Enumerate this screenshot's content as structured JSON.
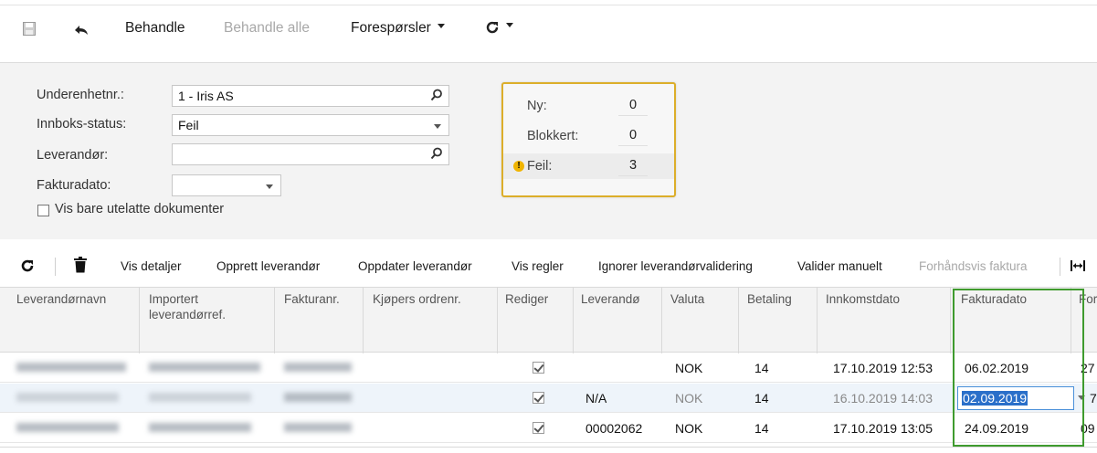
{
  "toolbar": {
    "process_label": "Behandle",
    "process_all_label": "Behandle alle",
    "requests_label": "Forespørsler"
  },
  "filters": {
    "subunit_label": "Underenhetnr.:",
    "subunit_value": "1 - Iris AS",
    "inbox_status_label": "Innboks-status:",
    "inbox_status_value": "Feil",
    "supplier_label": "Leverandør:",
    "supplier_value": "",
    "invoice_date_label": "Fakturadato:",
    "invoice_date_value": "",
    "omitted_only_label": "Vis bare utelatte dokumenter"
  },
  "counts": {
    "new_label": "Ny:",
    "new_value": "0",
    "blocked_label": "Blokkert:",
    "blocked_value": "0",
    "error_label": "Feil:",
    "error_value": "3"
  },
  "grid_toolbar": {
    "details": "Vis detaljer",
    "create_supplier": "Opprett leverandør",
    "update_supplier": "Oppdater leverandør",
    "rules": "Vis regler",
    "ignore_validation": "Ignorer leverandørvalidering",
    "validate_manual": "Valider manuelt",
    "preview_invoice": "Forhåndsvis faktura"
  },
  "grid": {
    "headers": {
      "supplier_name": "Leverandørnavn",
      "imported_ref": "Importert leverandørref.",
      "invoice_no": "Fakturanr.",
      "buyer_order": "Kjøpers ordrenr.",
      "edit": "Rediger",
      "supplier": "Leverandø",
      "currency": "Valuta",
      "payment": "Betaling",
      "received": "Innkomstdato",
      "invoice_date": "Fakturadato",
      "next": "For"
    },
    "rows": [
      {
        "supplier": "",
        "currency": "NOK",
        "payment": "14",
        "received": "17.10.2019 12:53",
        "invoice_date": "06.02.2019",
        "next": "27"
      },
      {
        "supplier": "N/A",
        "currency": "NOK",
        "payment": "14",
        "received": "16.10.2019 14:03",
        "invoice_date": "02.09.2019",
        "next": "7"
      },
      {
        "supplier": "00002062",
        "currency": "NOK",
        "payment": "14",
        "received": "17.10.2019 13:05",
        "invoice_date": "24.09.2019",
        "next": "09"
      }
    ]
  },
  "colors": {
    "count_border": "#dcae2a",
    "highlight_border": "#3f9b2e",
    "selection": "#2a6fc9"
  }
}
